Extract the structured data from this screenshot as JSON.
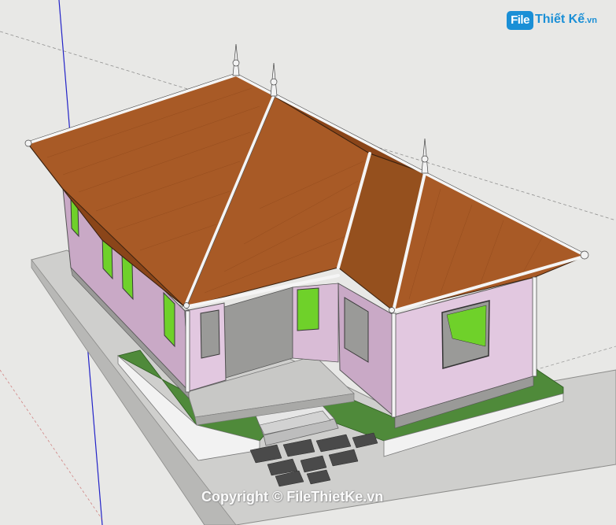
{
  "watermark": {
    "logo_file": "File",
    "logo_name": "Thiết Kế",
    "logo_tld": ".vn",
    "copyright": "Copyright © FileThietKe.vn"
  },
  "colors": {
    "background": "#e8e8e6",
    "roof": "#a85a26",
    "roof_dark": "#8a4519",
    "wall": "#e2c8e0",
    "wall_shade": "#c9a9c6",
    "grass": "#4f8a3a",
    "window_glass": "#6fd12a",
    "slab": "#cfcfcd",
    "axis_blue": "#2323c8",
    "axis_green": "#1fb43a"
  }
}
